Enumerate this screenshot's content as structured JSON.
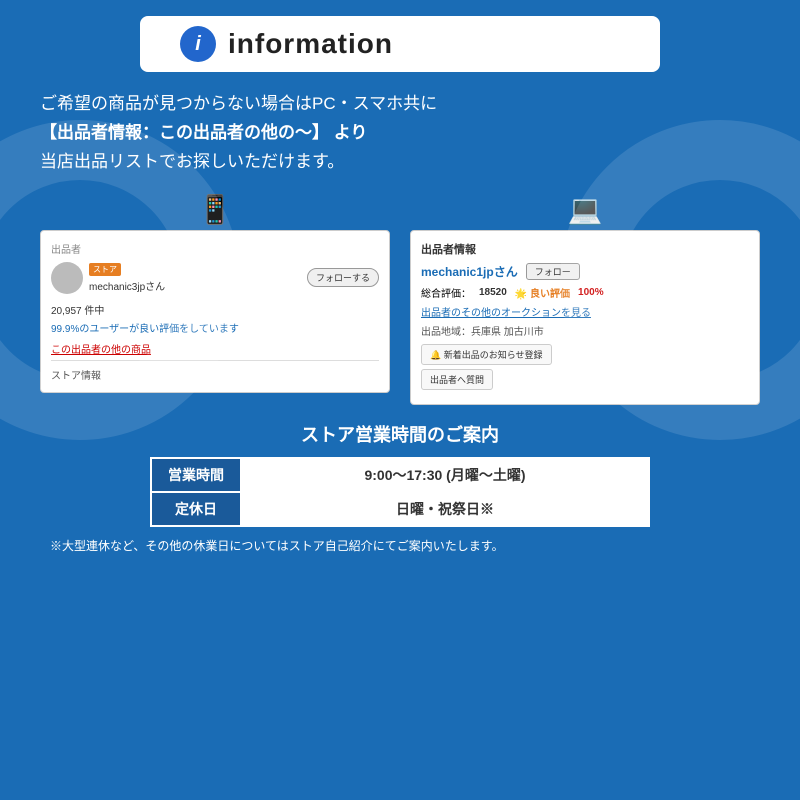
{
  "page": {
    "bg_color": "#1a6cb5"
  },
  "header": {
    "info_icon": "i",
    "title": "information"
  },
  "main_text": {
    "line1": "ご希望の商品が見つからない場合はPC・スマホ共に",
    "line2": "【出品者情報：この出品者の他の〜】 より",
    "line3": "当店出品リストでお探しいただけます。"
  },
  "mobile_device_icon": "📱",
  "pc_device_icon": "💻",
  "mobile_screenshot": {
    "section_label": "出品者",
    "store_badge": "ストア",
    "username": "mechanic3jpさん",
    "follow_btn": "フォローする",
    "count": "20,957 件中",
    "rating_text": "99.9%のユーザーが良い評価をしています",
    "link": "この出品者の他の商品",
    "store_info": "ストア情報"
  },
  "pc_screenshot": {
    "title": "出品者情報",
    "username": "mechanic1jpさん",
    "follow_btn": "フォロー",
    "rating_label": "総合評価：",
    "rating_num": "18520",
    "good_label": "🌟 良い評価",
    "good_pct": "100%",
    "auction_link": "出品者のその他のオークションを見る",
    "location": "出品地域：兵庫県 加古川市",
    "notify_btn": "🔔 新着出品のお知らせ登録",
    "question_btn": "出品者へ質問"
  },
  "store_hours": {
    "title": "ストア営業時間のご案内",
    "rows": [
      {
        "label": "営業時間",
        "value": "9:00〜17:30 (月曜〜土曜)"
      },
      {
        "label": "定休日",
        "value": "日曜・祝祭日※"
      }
    ],
    "footer_note": "※大型連休など、その他の休業日についてはストア自己紹介にてご案内いたします。"
  }
}
